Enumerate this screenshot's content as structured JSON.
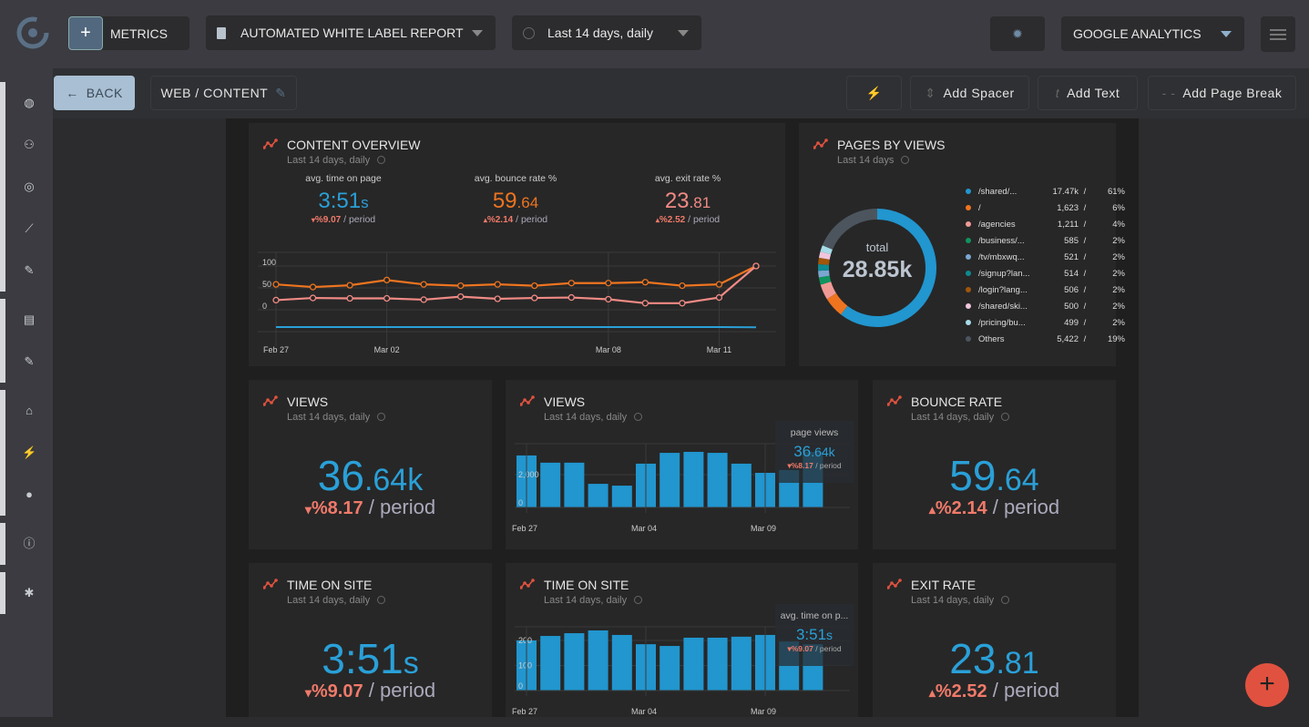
{
  "topbar": {
    "metrics_label": "METRICS",
    "report_label": "AUTOMATED WHITE LABEL REPORT",
    "date_label": "Last 14 days, daily",
    "source_label": "GOOGLE ANALYTICS"
  },
  "toolbar": {
    "back_label": "BACK",
    "breadcrumb": "WEB / CONTENT",
    "add_spacer": "Add Spacer",
    "add_text": "Add Text",
    "add_page_break": "Add Page Break"
  },
  "sidebar": {
    "icons": [
      "globe-icon",
      "users-icon",
      "target-icon",
      "chart-line-icon",
      "brush-icon",
      "clipboard-icon",
      "brush-icon",
      "bank-icon",
      "plug-icon",
      "account-icon",
      "info-icon",
      "bug-icon"
    ]
  },
  "colors": {
    "accent": "#2aa0d8",
    "orange": "#ee7420",
    "pink": "#f08a85",
    "negative": "#f07a6a"
  },
  "overview": {
    "title": "CONTENT OVERVIEW",
    "subtitle": "Last 14 days, daily",
    "kpis": [
      {
        "label": "avg. time on page",
        "main": "3:51",
        "suffix": "s",
        "change": "%9.07",
        "dir": "▾",
        "period": "/ period"
      },
      {
        "label": "avg. bounce rate %",
        "main": "59",
        "suffix": ".64",
        "change": "%2.14",
        "dir": "▴",
        "period": "/ period"
      },
      {
        "label": "avg. exit rate %",
        "main": "23",
        "suffix": ".81",
        "change": "%2.52",
        "dir": "▴",
        "period": "/ period"
      }
    ]
  },
  "chart_data": [
    {
      "type": "line",
      "x": [
        "Feb 27",
        "Feb 28",
        "Mar 01",
        "Mar 02",
        "Mar 03",
        "Mar 04",
        "Mar 05",
        "Mar 06",
        "Mar 07",
        "Mar 08",
        "Mar 09",
        "Mar 10",
        "Mar 11",
        "Mar 12"
      ],
      "x_tick_labels": [
        "Feb 27",
        "Mar 02",
        "Mar 08",
        "Mar 11"
      ],
      "y_ticks": [
        "100",
        "50",
        "0"
      ],
      "ylim": [
        -50,
        130
      ],
      "series": [
        {
          "key": "bounce",
          "color": "#ee7420",
          "values": [
            58,
            52,
            56,
            68,
            58,
            55,
            58,
            55,
            61,
            61,
            63,
            55,
            58,
            100
          ]
        },
        {
          "key": "exit",
          "color": "#f08a85",
          "values": [
            22,
            27,
            26,
            26,
            23,
            30,
            25,
            27,
            28,
            24,
            15,
            15,
            28,
            100
          ]
        },
        {
          "key": "time",
          "color": "#2aa0d8",
          "values": [
            231,
            231,
            231,
            231,
            231,
            231,
            231,
            231,
            231,
            231,
            231,
            231,
            231,
            230
          ]
        }
      ]
    },
    {
      "type": "pie",
      "total_label": "total",
      "total": "28.85k",
      "slices": [
        {
          "name": "/shared/...",
          "value": "17.47k",
          "pct": "61%",
          "num": 17470,
          "color": "#2196cf"
        },
        {
          "name": "/",
          "value": "1,623",
          "pct": "6%",
          "num": 1623,
          "color": "#ee7420"
        },
        {
          "name": "/agencies",
          "value": "1,211",
          "pct": "4%",
          "num": 1211,
          "color": "#ef9a95"
        },
        {
          "name": "/business/...",
          "value": "585",
          "pct": "2%",
          "num": 585,
          "color": "#10935f"
        },
        {
          "name": "/tv/mbxwq...",
          "value": "521",
          "pct": "2%",
          "num": 521,
          "color": "#7ba6d0"
        },
        {
          "name": "/signup?lan...",
          "value": "514",
          "pct": "2%",
          "num": 514,
          "color": "#0d8a91"
        },
        {
          "name": "/login?lang...",
          "value": "506",
          "pct": "2%",
          "num": 506,
          "color": "#a0560a"
        },
        {
          "name": "/shared/ski...",
          "value": "500",
          "pct": "2%",
          "num": 500,
          "color": "#f0c6dc"
        },
        {
          "name": "/pricing/bu...",
          "value": "499",
          "pct": "2%",
          "num": 499,
          "color": "#a6dce8"
        },
        {
          "name": "Others",
          "value": "5,422",
          "pct": "19%",
          "num": 5422,
          "color": "#4c555e"
        }
      ]
    },
    {
      "type": "bar",
      "x_tick_labels": [
        "Feb 27",
        "Mar 04",
        "Mar 09"
      ],
      "y_ticks": [
        "2,000",
        "0"
      ],
      "ylim": [
        0,
        4000
      ],
      "values": [
        3170,
        2730,
        2730,
        1440,
        1330,
        2670,
        3330,
        3390,
        3330,
        2670,
        2110,
        2280,
        3390
      ]
    },
    {
      "type": "bar",
      "x_tick_labels": [
        "Feb 27",
        "Mar 04",
        "Mar 09"
      ],
      "y_ticks": [
        "200",
        "100",
        "0"
      ],
      "ylim": [
        0,
        300
      ],
      "values": [
        200,
        218,
        229,
        240,
        222,
        185,
        178,
        211,
        211,
        215,
        222,
        196,
        185
      ]
    }
  ],
  "pages": {
    "title": "PAGES BY VIEWS",
    "subtitle": "Last 14 days"
  },
  "views_kpi": {
    "title": "VIEWS",
    "subtitle": "Last 14 days, daily",
    "main": "36",
    "suffix": ".64k",
    "dir": "▾",
    "change": "%8.17",
    "period": "/ period"
  },
  "views_chart": {
    "title": "VIEWS",
    "subtitle": "Last 14 days, daily",
    "overlay_label": "page views",
    "main": "36",
    "suffix": ".64k",
    "dir": "▾",
    "change": "%8.17",
    "period": "/ period"
  },
  "bounce_kpi": {
    "title": "BOUNCE RATE",
    "subtitle": "Last 14 days, daily",
    "main": "59",
    "suffix": ".64",
    "dir": "▴",
    "change": "%2.14",
    "period": "/ period"
  },
  "tos_kpi": {
    "title": "TIME ON SITE",
    "subtitle": "Last 14 days, daily",
    "main": "3:51",
    "suffix": "s",
    "dir": "▾",
    "change": "%9.07",
    "period": "/ period"
  },
  "tos_chart": {
    "title": "TIME ON SITE",
    "subtitle": "Last 14 days, daily",
    "overlay_label": "avg. time on p...",
    "main": "3:51",
    "suffix": "s",
    "dir": "▾",
    "change": "%9.07",
    "period": "/ period"
  },
  "exit_kpi": {
    "title": "EXIT RATE",
    "subtitle": "Last 14 days, daily",
    "main": "23",
    "suffix": ".81",
    "dir": "▴",
    "change": "%2.52",
    "period": "/ period"
  },
  "fab": {
    "label": "+"
  }
}
